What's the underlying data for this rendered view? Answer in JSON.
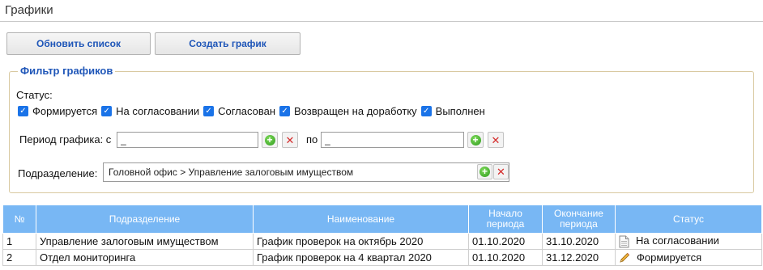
{
  "page": {
    "title": "Графики"
  },
  "toolbar": {
    "refresh_label": "Обновить список",
    "create_label": "Создать график"
  },
  "filter": {
    "legend": "Фильтр графиков",
    "status_label": "Статус:",
    "statuses": [
      {
        "label": "Формируется",
        "checked": true
      },
      {
        "label": "На согласовании",
        "checked": true
      },
      {
        "label": "Согласован",
        "checked": true
      },
      {
        "label": "Возвращен на доработку",
        "checked": true
      },
      {
        "label": "Выполнен",
        "checked": true
      }
    ],
    "period_label": "Период графика: с",
    "period_from": "_",
    "period_to_label": "по",
    "period_to": "_",
    "department_label": "Подразделение:",
    "department_value": "Головной офис > Управление залоговым имуществом"
  },
  "table": {
    "headers": {
      "num": "№",
      "department": "Подразделение",
      "name": "Наименование",
      "start": "Начало периода",
      "end": "Окончание периода",
      "status": "Статус"
    },
    "rows": [
      {
        "num": "1",
        "department": "Управление залоговым имуществом",
        "name": "График проверок на октябрь 2020",
        "start": "01.10.2020",
        "end": "31.10.2020",
        "status": "На согласовании",
        "status_icon": "document-icon"
      },
      {
        "num": "2",
        "department": "Отдел мониторинга",
        "name": "График проверок на 4 квартал 2020",
        "start": "01.10.2020",
        "end": "31.12.2020",
        "status": "Формируется",
        "status_icon": "pencil-icon"
      }
    ]
  },
  "colors": {
    "accent": "#1f56b8",
    "header_bg": "#78b7f4",
    "checkbox": "#1a73e8"
  }
}
